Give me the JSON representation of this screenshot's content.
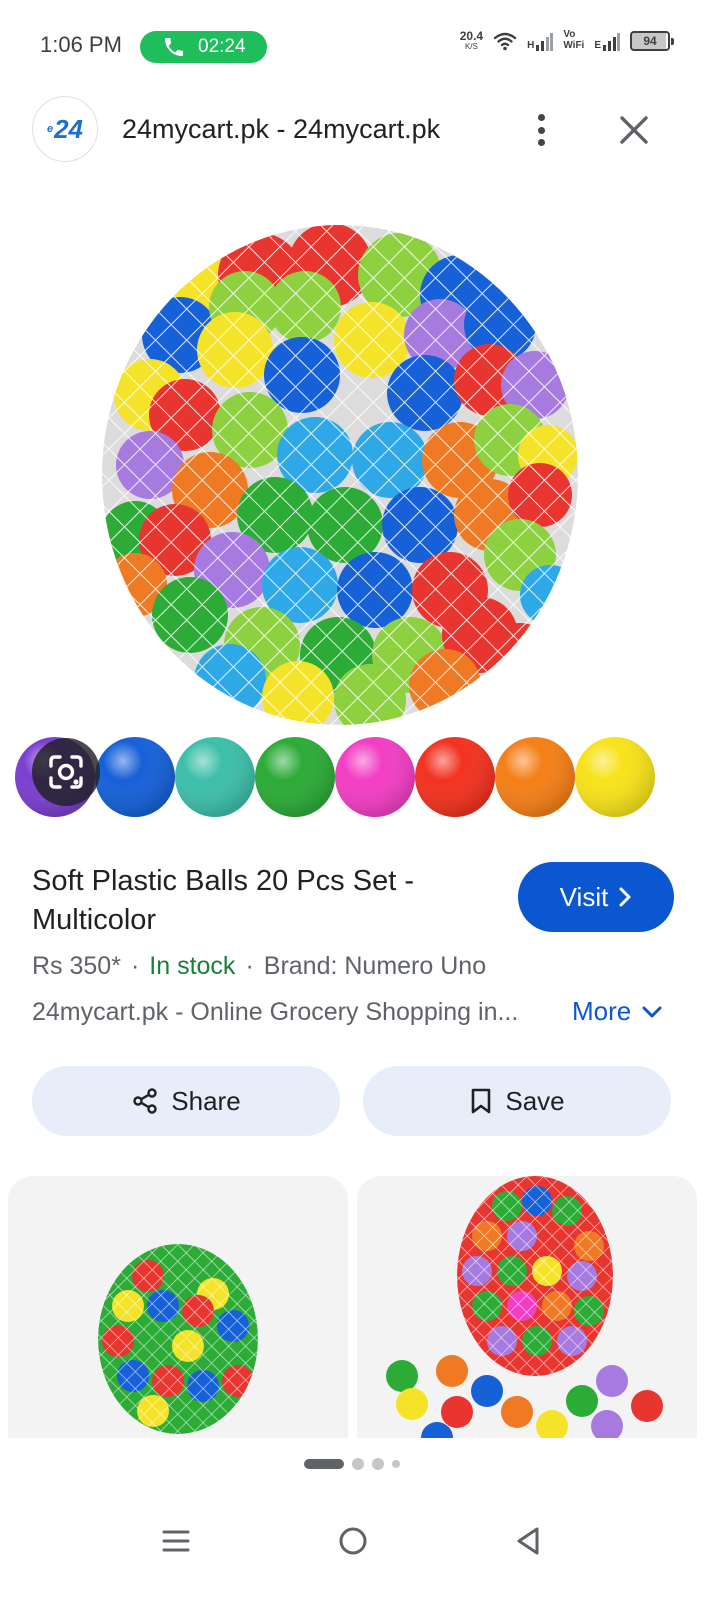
{
  "status_bar": {
    "time": "1:06 PM",
    "call_timer": "02:24",
    "net_speed_value": "20.4",
    "net_speed_unit": "K/S",
    "net1_label": "H",
    "vowifi_line1": "Vo",
    "vowifi_line2": "WiFi",
    "net2_label": "E",
    "battery": "94"
  },
  "header": {
    "logo_text": "24",
    "title": "24mycart.pk - 24mycart.pk"
  },
  "product": {
    "title": "Soft Plastic Balls 20 Pcs Set - Multicolor",
    "visit_label": "Visit",
    "price": "Rs 350*",
    "stock": "In stock",
    "brand": "Brand: Numero Uno",
    "description": "24mycart.pk - Online Grocery Shopping in...",
    "more_label": "More"
  },
  "actions": {
    "share_label": "Share",
    "save_label": "Save"
  },
  "colors": {
    "accent": "#0b57d0",
    "in_stock": "#188038",
    "call_green": "#1fbe5c",
    "chip_bg": "#e8eef9"
  },
  "icons": [
    "phone-icon",
    "wifi-icon",
    "signal-icon",
    "battery-icon",
    "more-vert-icon",
    "close-icon",
    "lens-icon",
    "chevron-right-icon",
    "chevron-down-icon",
    "share-icon",
    "bookmark-icon",
    "menu-icon",
    "home-icon",
    "back-icon"
  ]
}
